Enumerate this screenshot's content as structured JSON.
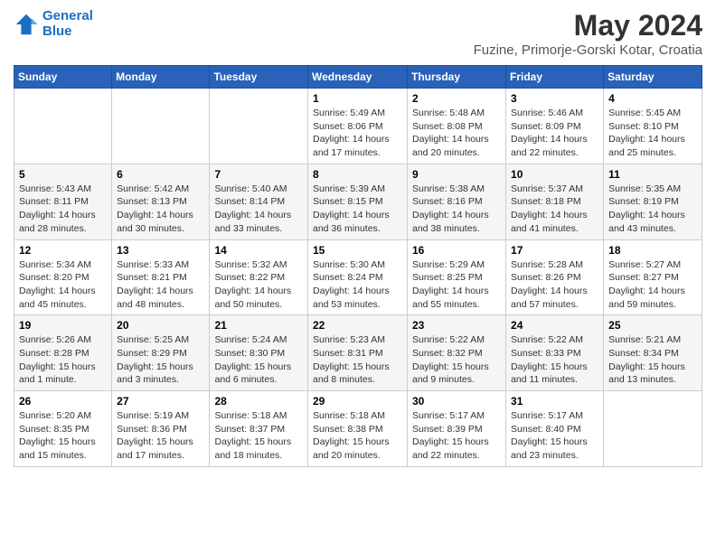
{
  "header": {
    "logo_line1": "General",
    "logo_line2": "Blue",
    "month_year": "May 2024",
    "location": "Fuzine, Primorje-Gorski Kotar, Croatia"
  },
  "weekdays": [
    "Sunday",
    "Monday",
    "Tuesday",
    "Wednesday",
    "Thursday",
    "Friday",
    "Saturday"
  ],
  "weeks": [
    [
      {
        "day": "",
        "info": ""
      },
      {
        "day": "",
        "info": ""
      },
      {
        "day": "",
        "info": ""
      },
      {
        "day": "1",
        "info": "Sunrise: 5:49 AM\nSunset: 8:06 PM\nDaylight: 14 hours and 17 minutes."
      },
      {
        "day": "2",
        "info": "Sunrise: 5:48 AM\nSunset: 8:08 PM\nDaylight: 14 hours and 20 minutes."
      },
      {
        "day": "3",
        "info": "Sunrise: 5:46 AM\nSunset: 8:09 PM\nDaylight: 14 hours and 22 minutes."
      },
      {
        "day": "4",
        "info": "Sunrise: 5:45 AM\nSunset: 8:10 PM\nDaylight: 14 hours and 25 minutes."
      }
    ],
    [
      {
        "day": "5",
        "info": "Sunrise: 5:43 AM\nSunset: 8:11 PM\nDaylight: 14 hours and 28 minutes."
      },
      {
        "day": "6",
        "info": "Sunrise: 5:42 AM\nSunset: 8:13 PM\nDaylight: 14 hours and 30 minutes."
      },
      {
        "day": "7",
        "info": "Sunrise: 5:40 AM\nSunset: 8:14 PM\nDaylight: 14 hours and 33 minutes."
      },
      {
        "day": "8",
        "info": "Sunrise: 5:39 AM\nSunset: 8:15 PM\nDaylight: 14 hours and 36 minutes."
      },
      {
        "day": "9",
        "info": "Sunrise: 5:38 AM\nSunset: 8:16 PM\nDaylight: 14 hours and 38 minutes."
      },
      {
        "day": "10",
        "info": "Sunrise: 5:37 AM\nSunset: 8:18 PM\nDaylight: 14 hours and 41 minutes."
      },
      {
        "day": "11",
        "info": "Sunrise: 5:35 AM\nSunset: 8:19 PM\nDaylight: 14 hours and 43 minutes."
      }
    ],
    [
      {
        "day": "12",
        "info": "Sunrise: 5:34 AM\nSunset: 8:20 PM\nDaylight: 14 hours and 45 minutes."
      },
      {
        "day": "13",
        "info": "Sunrise: 5:33 AM\nSunset: 8:21 PM\nDaylight: 14 hours and 48 minutes."
      },
      {
        "day": "14",
        "info": "Sunrise: 5:32 AM\nSunset: 8:22 PM\nDaylight: 14 hours and 50 minutes."
      },
      {
        "day": "15",
        "info": "Sunrise: 5:30 AM\nSunset: 8:24 PM\nDaylight: 14 hours and 53 minutes."
      },
      {
        "day": "16",
        "info": "Sunrise: 5:29 AM\nSunset: 8:25 PM\nDaylight: 14 hours and 55 minutes."
      },
      {
        "day": "17",
        "info": "Sunrise: 5:28 AM\nSunset: 8:26 PM\nDaylight: 14 hours and 57 minutes."
      },
      {
        "day": "18",
        "info": "Sunrise: 5:27 AM\nSunset: 8:27 PM\nDaylight: 14 hours and 59 minutes."
      }
    ],
    [
      {
        "day": "19",
        "info": "Sunrise: 5:26 AM\nSunset: 8:28 PM\nDaylight: 15 hours and 1 minute."
      },
      {
        "day": "20",
        "info": "Sunrise: 5:25 AM\nSunset: 8:29 PM\nDaylight: 15 hours and 3 minutes."
      },
      {
        "day": "21",
        "info": "Sunrise: 5:24 AM\nSunset: 8:30 PM\nDaylight: 15 hours and 6 minutes."
      },
      {
        "day": "22",
        "info": "Sunrise: 5:23 AM\nSunset: 8:31 PM\nDaylight: 15 hours and 8 minutes."
      },
      {
        "day": "23",
        "info": "Sunrise: 5:22 AM\nSunset: 8:32 PM\nDaylight: 15 hours and 9 minutes."
      },
      {
        "day": "24",
        "info": "Sunrise: 5:22 AM\nSunset: 8:33 PM\nDaylight: 15 hours and 11 minutes."
      },
      {
        "day": "25",
        "info": "Sunrise: 5:21 AM\nSunset: 8:34 PM\nDaylight: 15 hours and 13 minutes."
      }
    ],
    [
      {
        "day": "26",
        "info": "Sunrise: 5:20 AM\nSunset: 8:35 PM\nDaylight: 15 hours and 15 minutes."
      },
      {
        "day": "27",
        "info": "Sunrise: 5:19 AM\nSunset: 8:36 PM\nDaylight: 15 hours and 17 minutes."
      },
      {
        "day": "28",
        "info": "Sunrise: 5:18 AM\nSunset: 8:37 PM\nDaylight: 15 hours and 18 minutes."
      },
      {
        "day": "29",
        "info": "Sunrise: 5:18 AM\nSunset: 8:38 PM\nDaylight: 15 hours and 20 minutes."
      },
      {
        "day": "30",
        "info": "Sunrise: 5:17 AM\nSunset: 8:39 PM\nDaylight: 15 hours and 22 minutes."
      },
      {
        "day": "31",
        "info": "Sunrise: 5:17 AM\nSunset: 8:40 PM\nDaylight: 15 hours and 23 minutes."
      },
      {
        "day": "",
        "info": ""
      }
    ]
  ]
}
